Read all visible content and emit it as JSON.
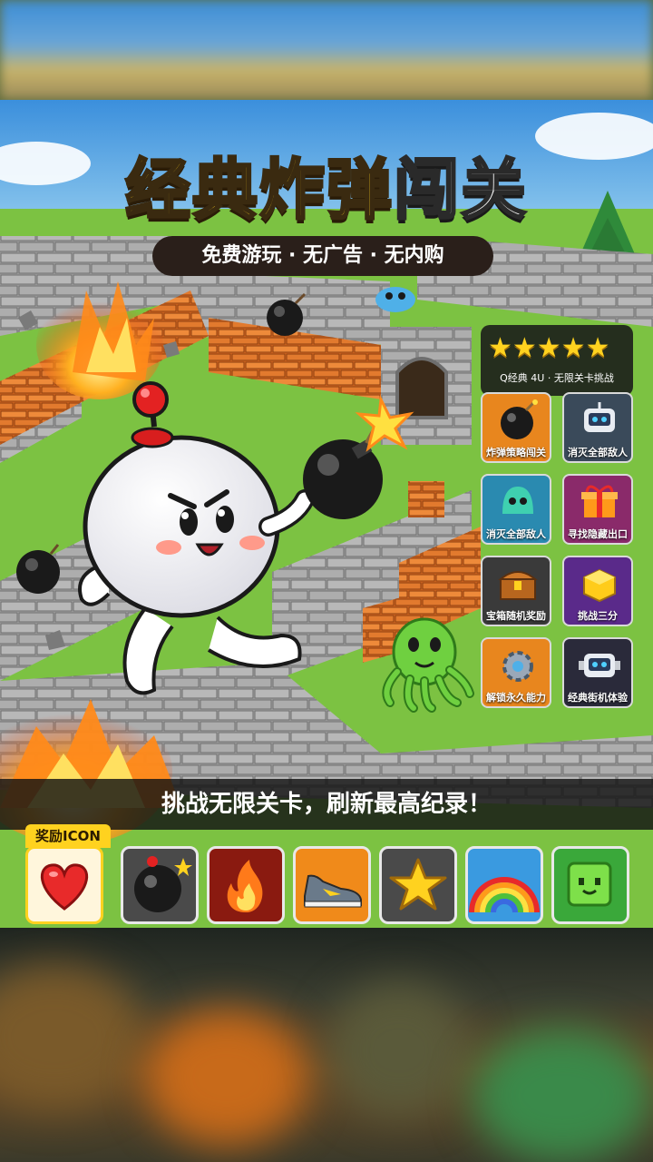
{
  "header": {
    "title_yellow": "经典炸弹",
    "title_white": "闯关",
    "subtitle": "免费游玩 · 无广告 · 无内购"
  },
  "rating": {
    "stars": "★★★★★",
    "caption": "Q经典 4U · 无限关卡挑战"
  },
  "features": [
    {
      "label": "炸弹策略闯关",
      "icon": "bomb-icon"
    },
    {
      "label": "消灭全部敌人",
      "icon": "robot-icon"
    },
    {
      "label": "消灭全部敌人",
      "icon": "slime-icon"
    },
    {
      "label": "寻找隐藏出口",
      "icon": "gift-icon"
    },
    {
      "label": "宝箱随机奖励",
      "icon": "chest-icon"
    },
    {
      "label": "挑战三分",
      "icon": "gold-cube-icon"
    },
    {
      "label": "解锁永久能力",
      "icon": "gear-icon"
    },
    {
      "label": "经典街机体验",
      "icon": "robot-icon"
    }
  ],
  "banner": {
    "text": "挑战无限关卡，刷新最高纪录！"
  },
  "rewards": {
    "label": "奖励ICON",
    "items": [
      "heart-icon",
      "bomb-icon",
      "fire-icon",
      "sneaker-icon",
      "star-icon",
      "rainbow-icon",
      "green-cube-icon"
    ]
  },
  "colors": {
    "title_yellow": "#ffd21f",
    "grass": "#7cc242",
    "stone": "#9a9a9a",
    "brick": "#e0782a"
  }
}
